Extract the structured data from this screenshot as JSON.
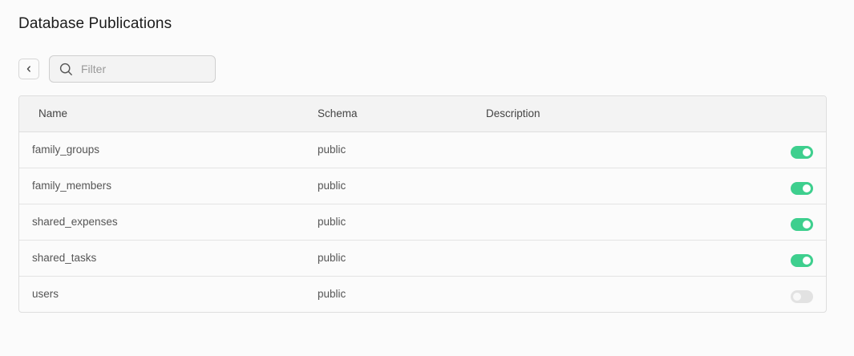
{
  "page": {
    "title": "Database Publications"
  },
  "toolbar": {
    "back_icon": "chevron-left-icon",
    "search": {
      "icon": "search-icon",
      "placeholder": "Filter",
      "value": ""
    }
  },
  "table": {
    "columns": [
      "Name",
      "Schema",
      "Description"
    ],
    "rows": [
      {
        "name": "family_groups",
        "schema": "public",
        "description": "",
        "enabled": true
      },
      {
        "name": "family_members",
        "schema": "public",
        "description": "",
        "enabled": true
      },
      {
        "name": "shared_expenses",
        "schema": "public",
        "description": "",
        "enabled": true
      },
      {
        "name": "shared_tasks",
        "schema": "public",
        "description": "",
        "enabled": true
      },
      {
        "name": "users",
        "schema": "public",
        "description": "",
        "enabled": false
      }
    ]
  },
  "colors": {
    "toggle_on": "#3ecf8e",
    "toggle_off": "#e2e2e2"
  }
}
